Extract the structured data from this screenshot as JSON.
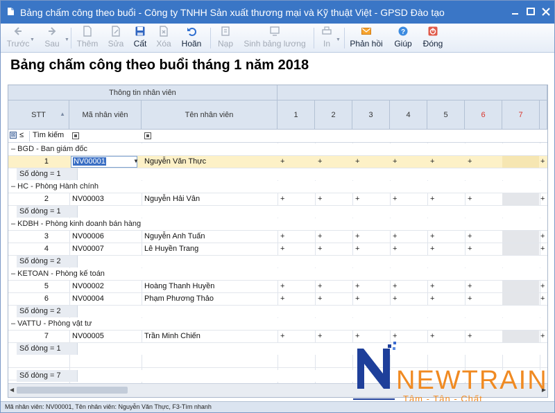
{
  "window": {
    "title": "Bảng chấm công theo buổi - Công ty TNHH Sản xuất thương mại và Kỹ thuật Việt - GPSD Đào tạo"
  },
  "toolbar": {
    "back": "Trước",
    "forward": "Sau",
    "add": "Thêm",
    "edit": "Sửa",
    "save": "Cất",
    "delete": "Xóa",
    "undo": "Hoãn",
    "load": "Nạp",
    "generate": "Sinh bảng lương",
    "print": "In",
    "feedback": "Phản hồi",
    "help": "Giúp",
    "close": "Đóng"
  },
  "heading": "Bảng chấm công theo buổi tháng 1 năm 2018",
  "grid": {
    "band_employee_info": "Thông tin nhân viên",
    "col_stt": "STT",
    "col_code": "Mã nhân viên",
    "col_name": "Tên nhân viên",
    "days": [
      {
        "label": "1",
        "weekend": false
      },
      {
        "label": "2",
        "weekend": false
      },
      {
        "label": "3",
        "weekend": false
      },
      {
        "label": "4",
        "weekend": false
      },
      {
        "label": "5",
        "weekend": false
      },
      {
        "label": "6",
        "weekend": true
      },
      {
        "label": "7",
        "weekend": true
      }
    ],
    "filter": {
      "operator": "≤",
      "search_label": "Tìm kiếm"
    },
    "groups": [
      {
        "title": "BGD - Ban giám đốc",
        "rows": [
          {
            "stt": "1",
            "code": "NV00001",
            "name": "Nguyễn Văn Thực",
            "marks": [
              "+",
              "+",
              "+",
              "+",
              "+",
              "+",
              "",
              "+"
            ]
          }
        ],
        "count": "Số dòng = 1"
      },
      {
        "title": "HC - Phòng Hành chính",
        "rows": [
          {
            "stt": "2",
            "code": "NV00003",
            "name": "Nguyễn Hải Vân",
            "marks": [
              "+",
              "+",
              "+",
              "+",
              "+",
              "+",
              "",
              "+"
            ]
          }
        ],
        "count": "Số dòng = 1"
      },
      {
        "title": "KDBH - Phòng kinh doanh bán hàng",
        "rows": [
          {
            "stt": "3",
            "code": "NV00006",
            "name": "Nguyễn Anh Tuấn",
            "marks": [
              "+",
              "+",
              "+",
              "+",
              "+",
              "+",
              "",
              "+"
            ]
          },
          {
            "stt": "4",
            "code": "NV00007",
            "name": "Lê Huyền Trang",
            "marks": [
              "+",
              "+",
              "+",
              "+",
              "+",
              "+",
              "",
              "+"
            ]
          }
        ],
        "count": "Số dòng = 2"
      },
      {
        "title": "KETOAN - Phòng kế toán",
        "rows": [
          {
            "stt": "5",
            "code": "NV00002",
            "name": "Hoàng Thanh Huyền",
            "marks": [
              "+",
              "+",
              "+",
              "+",
              "+",
              "+",
              "",
              "+"
            ]
          },
          {
            "stt": "6",
            "code": "NV00004",
            "name": "Phạm Phương Thảo",
            "marks": [
              "+",
              "+",
              "+",
              "+",
              "+",
              "+",
              "",
              "+"
            ]
          }
        ],
        "count": "Số dòng = 2"
      },
      {
        "title": "VATTU - Phòng vật tư",
        "rows": [
          {
            "stt": "7",
            "code": "NV00005",
            "name": "Trần Minh Chiến",
            "marks": [
              "+",
              "+",
              "+",
              "+",
              "+",
              "+",
              "",
              "+"
            ]
          }
        ],
        "count": "Số dòng = 1"
      }
    ],
    "total_count": "Số dòng = 7"
  },
  "watermark": {
    "brand": "NEWTRAIN",
    "slogan": "Tâm - Tận - Chất"
  },
  "status_bar": "Mã nhân viên: NV00001, Tên nhân viên: Nguyễn Văn Thực, F3-Tìm nhanh",
  "colors": {
    "titlebar": "#3a76c6",
    "weekend": "#d9342b",
    "selection": "#fdf1c7",
    "brand_blue": "#1e3f9a",
    "brand_orange": "#f08a22"
  }
}
